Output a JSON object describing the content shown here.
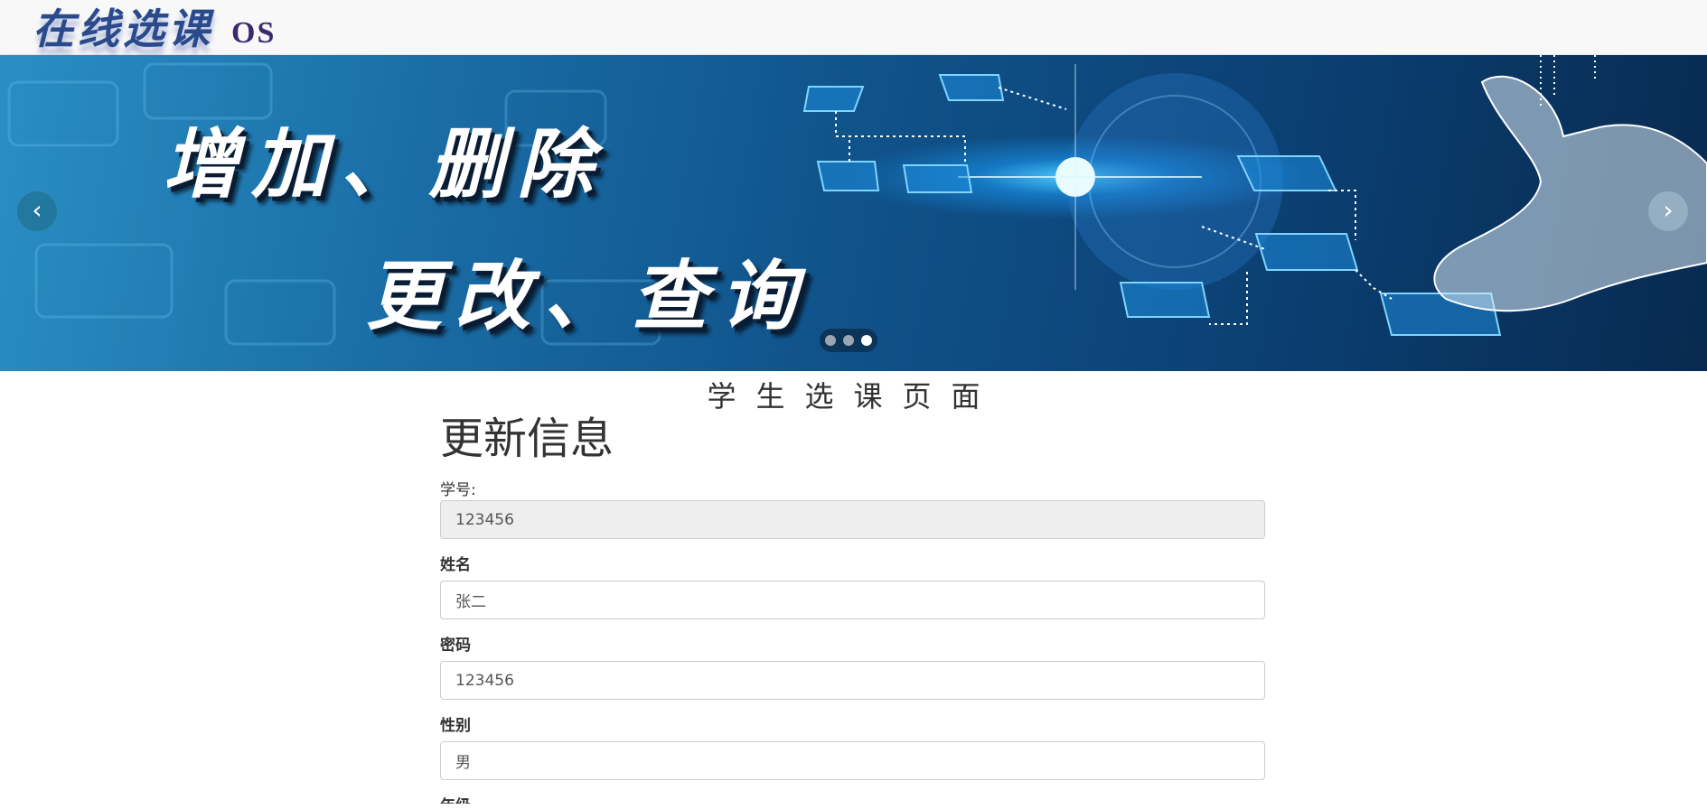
{
  "navbar": {
    "logo_cn": "在线选课",
    "logo_os": "OS"
  },
  "carousel": {
    "line1": "增加、删除",
    "line2": "更改、查询",
    "prev_icon": "chevron-left",
    "next_icon": "chevron-right",
    "indicator_count": 3,
    "active_index": 2
  },
  "page": {
    "heading": "学生选课页面"
  },
  "form": {
    "title": "更新信息",
    "student_id_label": "学号:",
    "student_id_value": "123456",
    "name_label": "姓名",
    "name_value": "张二",
    "password_label": "密码",
    "password_value": "123456",
    "gender_label": "性别",
    "gender_value": "男",
    "next_label": "年级"
  }
}
